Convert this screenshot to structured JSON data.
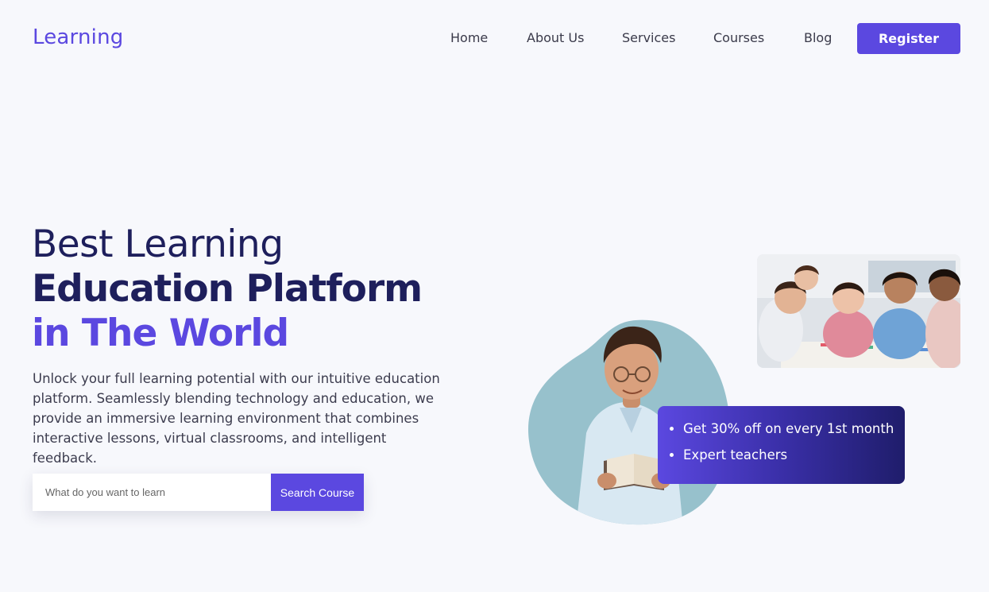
{
  "header": {
    "logo": "Learning",
    "nav": [
      {
        "label": "Home"
      },
      {
        "label": "About Us"
      },
      {
        "label": "Services"
      },
      {
        "label": "Courses"
      },
      {
        "label": "Blog"
      }
    ],
    "register_label": "Register"
  },
  "hero": {
    "line1": "Best Learning",
    "line2": "Education Platform",
    "line3": "in The World",
    "description": "Unlock your full learning potential with our intuitive education platform. Seamlessly blending technology and education, we provide an immersive learning environment that combines interactive lessons, virtual classrooms, and intelligent feedback."
  },
  "search": {
    "placeholder": "What do you want to learn",
    "value": "",
    "button_label": "Search Course"
  },
  "promo": {
    "items": [
      {
        "text": "Get 30% off on every 1st month"
      },
      {
        "text": "Expert teachers"
      }
    ]
  },
  "images": {
    "student": "boy-reading-book-image",
    "classroom": "children-classroom-image"
  },
  "colors": {
    "accent": "#5b48e0",
    "heading": "#1e1f5c",
    "background": "#f7f8fc",
    "blob": "#97c1cc",
    "promo_end": "#1f1d6b"
  }
}
